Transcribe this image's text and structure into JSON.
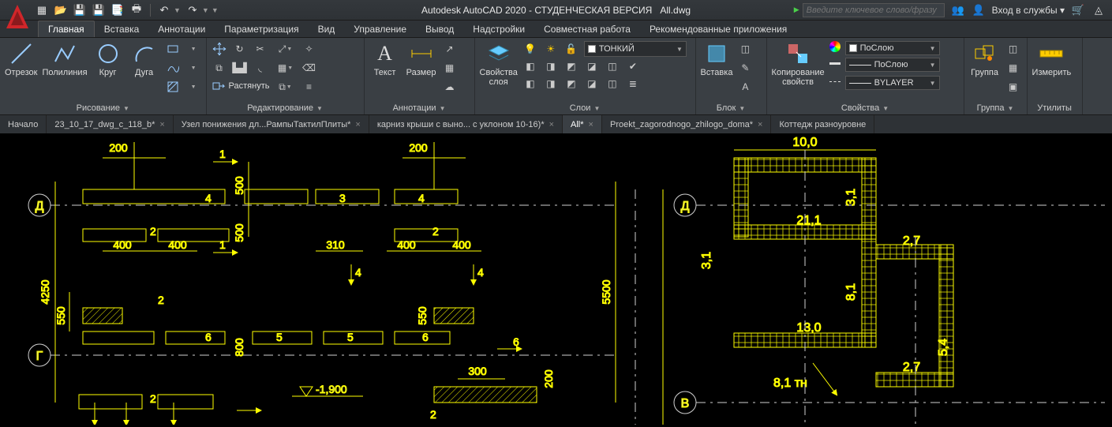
{
  "app": {
    "title_prefix": "Autodesk AutoCAD 2020 - СТУДЕНЧЕСКАЯ ВЕРСИЯ",
    "filename": "All.dwg",
    "search_placeholder": "Введите ключевое слово/фразу",
    "signin": "Вход в службы"
  },
  "ribbon_tabs": {
    "active": "Главная",
    "items": [
      "Главная",
      "Вставка",
      "Аннотации",
      "Параметризация",
      "Вид",
      "Управление",
      "Вывод",
      "Надстройки",
      "Совместная работа",
      "Рекомендованные приложения"
    ]
  },
  "panels": {
    "draw": {
      "title": "Рисование",
      "line": "Отрезок",
      "polyline": "Полилиния",
      "circle": "Круг",
      "arc": "Дуга"
    },
    "modify": {
      "title": "Редактирование",
      "stretch": "Растянуть"
    },
    "annotation": {
      "title": "Аннотации",
      "text": "Текст",
      "dim": "Размер"
    },
    "layers": {
      "title": "Слои",
      "props": "Свойства\nслоя",
      "current": "ТОНКИЙ"
    },
    "block": {
      "title": "Блок",
      "insert": "Вставка"
    },
    "props": {
      "title": "Свойства",
      "match": "Копирование\nсвойств",
      "color": "ПоСлою",
      "lineweight": "ПоСлою",
      "linetype": "BYLAYER"
    },
    "group": {
      "title": "Группа",
      "label": "Группа"
    },
    "utils": {
      "title": "Утилиты",
      "measure": "Измерить"
    }
  },
  "file_tabs": [
    {
      "label": "Начало",
      "closable": false
    },
    {
      "label": "23_10_17_dwg_c_118_b*",
      "closable": true
    },
    {
      "label": "Узел понижения дл...РампыТактилПлиты*",
      "closable": true
    },
    {
      "label": "карниз крыши с выно... с уклоном 10-16)*",
      "closable": true
    },
    {
      "label": "All*",
      "closable": true,
      "active": true
    },
    {
      "label": "Proekt_zagorodnogo_zhilogo_doma*",
      "closable": true
    },
    {
      "label": "Коттедж разноуровне",
      "closable": false
    }
  ],
  "drawing": {
    "left": {
      "grid_labels": [
        "Д",
        "Г"
      ],
      "dim_vertical_main": "4250",
      "dim_550_a": "550",
      "dim_550_b": "550",
      "dim_200_a": "200",
      "dim_200_b": "200",
      "dim_500_a": "500",
      "dim_500_b": "500",
      "dim_800": "800",
      "dim_400_a": "400",
      "dim_400_b": "400",
      "dim_400_c": "400",
      "dim_400_d": "400",
      "dim_310": "310",
      "dim_300": "300",
      "dim_200_c": "200",
      "elevation": "-1,900",
      "dim_5500": "5500",
      "markers": {
        "m1": "1",
        "m2": "2",
        "m4": "4",
        "m3": "3",
        "m5": "5",
        "m6": "6"
      }
    },
    "right": {
      "grid_labels": [
        "Д",
        "В"
      ],
      "dim_10_0": "10,0",
      "dim_3_1_a": "3,1",
      "dim_3_1_b": "3,1",
      "dim_21_1": "21,1",
      "dim_2_7_a": "2,7",
      "dim_2_7_b": "2,7",
      "dim_8_1": "8,1",
      "dim_5_4": "5,4",
      "dim_13_0": "13,0",
      "dim_8_1_tn": "8,1 тн"
    }
  }
}
